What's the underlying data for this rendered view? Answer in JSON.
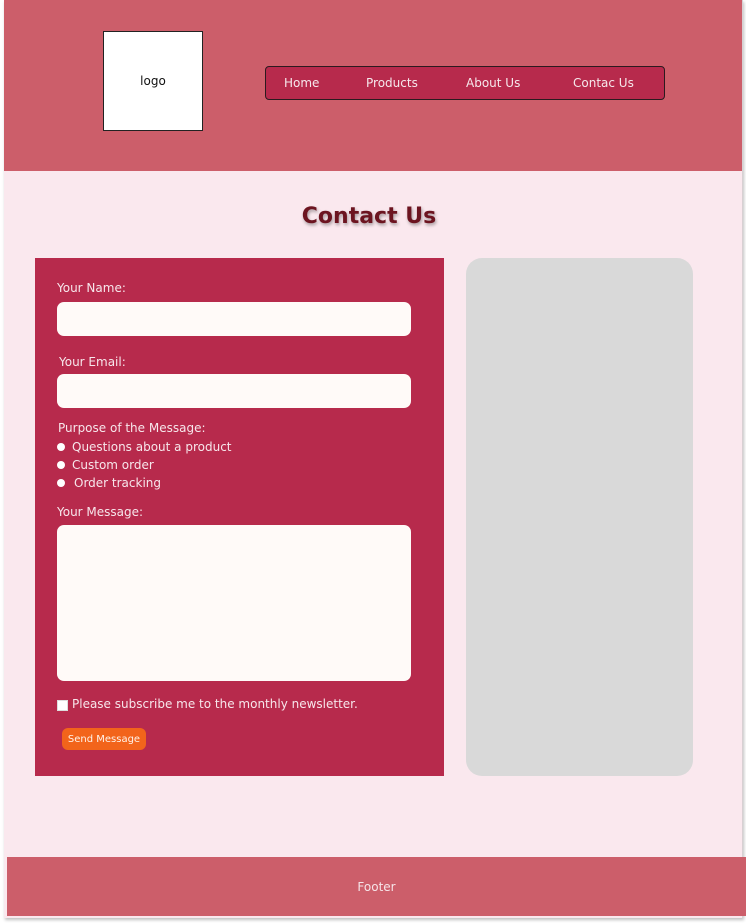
{
  "header": {
    "logo_text": "logo",
    "nav": [
      "Home",
      "Products",
      "About Us",
      "Contac Us"
    ]
  },
  "page_title": "Contact Us",
  "form": {
    "name_label": "Your Name:",
    "name_value": "",
    "email_label": "Your Email:",
    "email_value": "",
    "purpose_label": "Purpose of the Message:",
    "purpose_options": [
      "Questions about a product",
      "Custom order",
      "Order tracking"
    ],
    "message_label": "Your Message:",
    "message_value": "",
    "newsletter_label": "Please subscribe me to the monthly newsletter.",
    "submit_label": "Send Message"
  },
  "footer": {
    "text": "Footer"
  },
  "colors": {
    "header_bg": "#cc5e6a",
    "page_bg": "#fae8ee",
    "form_bg": "#b72a4c",
    "title": "#6c1420",
    "button": "#f2641b",
    "side_panel": "#d9d9d9"
  }
}
